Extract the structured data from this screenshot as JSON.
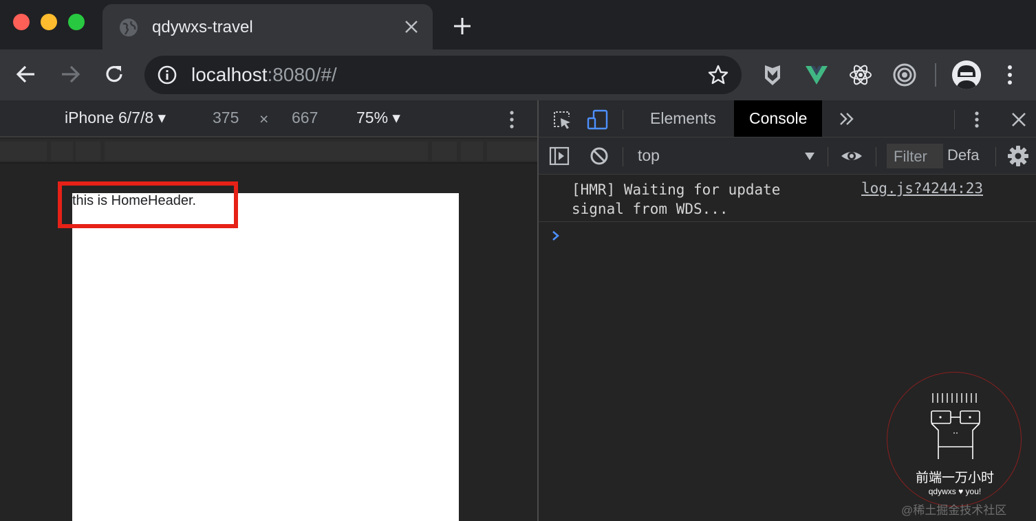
{
  "window": {
    "controls": [
      "close",
      "minimize",
      "zoom"
    ]
  },
  "tab": {
    "title": "qdywxs-travel"
  },
  "toolbar": {
    "url_host": "localhost",
    "url_rest": ":8080/#/",
    "extensions": [
      "shield-extension",
      "vue-devtools",
      "react-devtools",
      "target-extension"
    ]
  },
  "device_toolbar": {
    "device": "iPhone 6/7/8",
    "width": "375",
    "times": "×",
    "height": "667",
    "zoom": "75%"
  },
  "page": {
    "home_header_text": "this is HomeHeader."
  },
  "devtools": {
    "tabs": [
      "Elements",
      "Console"
    ],
    "active_tab": "Console",
    "context": "top",
    "filter_placeholder": "Filter",
    "levels_label": "Defa",
    "messages": [
      {
        "text": "[HMR] Waiting for update signal from WDS...",
        "source": "log.js?4244:23"
      }
    ]
  },
  "watermark": {
    "title": "前端一万小时",
    "subtitle": "qdywxs ♥ you!",
    "site": "@稀土掘金技术社区"
  },
  "colors": {
    "highlight": "#e62117",
    "prompt": "#4d90fe",
    "vue": "#41b883"
  }
}
